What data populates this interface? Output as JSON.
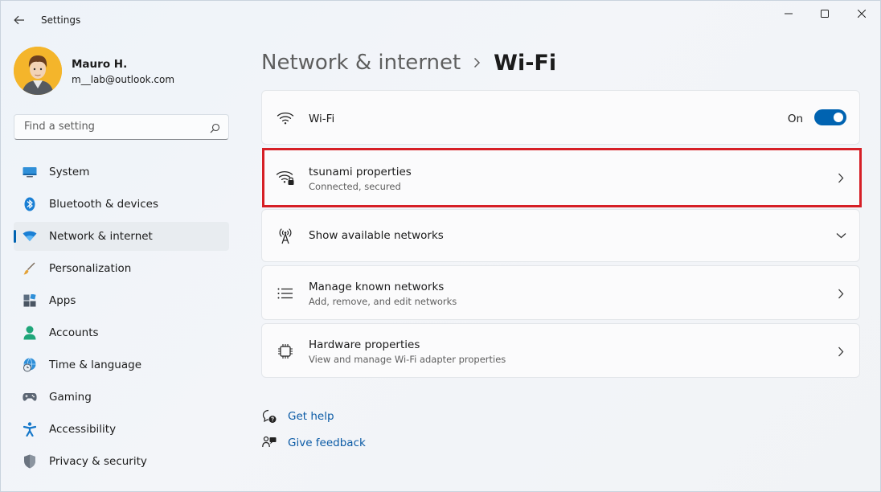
{
  "window": {
    "app_title": "Settings"
  },
  "user": {
    "name": "Mauro H.",
    "email": "m__lab@outlook.com"
  },
  "search": {
    "placeholder": "Find a setting",
    "value": ""
  },
  "sidebar": {
    "items": [
      {
        "label": "System",
        "icon": "system-icon"
      },
      {
        "label": "Bluetooth & devices",
        "icon": "bluetooth-icon"
      },
      {
        "label": "Network & internet",
        "icon": "wifi-icon",
        "active": true
      },
      {
        "label": "Personalization",
        "icon": "brush-icon"
      },
      {
        "label": "Apps",
        "icon": "apps-icon"
      },
      {
        "label": "Accounts",
        "icon": "person-icon"
      },
      {
        "label": "Time & language",
        "icon": "globe-clock-icon"
      },
      {
        "label": "Gaming",
        "icon": "gamepad-icon"
      },
      {
        "label": "Accessibility",
        "icon": "accessibility-icon"
      },
      {
        "label": "Privacy & security",
        "icon": "shield-icon"
      }
    ]
  },
  "breadcrumb": {
    "parent": "Network & internet",
    "current": "Wi-Fi"
  },
  "cards": {
    "wifi": {
      "title": "Wi-Fi",
      "toggle_label": "On",
      "toggle_on": true
    },
    "properties": {
      "title": "tsunami properties",
      "subtitle": "Connected, secured"
    },
    "available": {
      "title": "Show available networks"
    },
    "known": {
      "title": "Manage known networks",
      "subtitle": "Add, remove, and edit networks"
    },
    "hardware": {
      "title": "Hardware properties",
      "subtitle": "View and manage Wi-Fi adapter properties"
    }
  },
  "links": {
    "help": "Get help",
    "feedback": "Give feedback"
  },
  "colors": {
    "accent": "#0063b1",
    "highlight": "#d61f26",
    "link": "#0a5aa5"
  }
}
